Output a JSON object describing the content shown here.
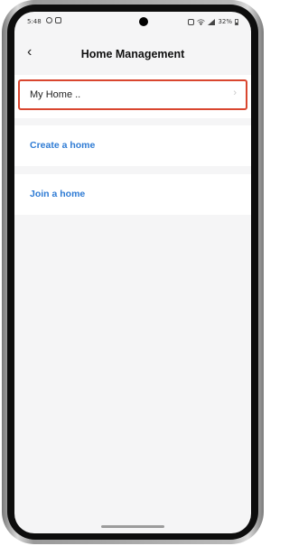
{
  "status_bar": {
    "time": "5:48",
    "battery": "32%"
  },
  "header": {
    "back_icon": "chevron-left-icon",
    "back_glyph": "‹",
    "title": "Home Management"
  },
  "homes": [
    {
      "label": "My Home ..",
      "chevron_glyph": "›"
    }
  ],
  "actions": {
    "create_label": "Create a home",
    "join_label": "Join a home"
  },
  "colors": {
    "link": "#2e7bd4",
    "highlight": "#d9462f",
    "background": "#f5f5f6"
  }
}
